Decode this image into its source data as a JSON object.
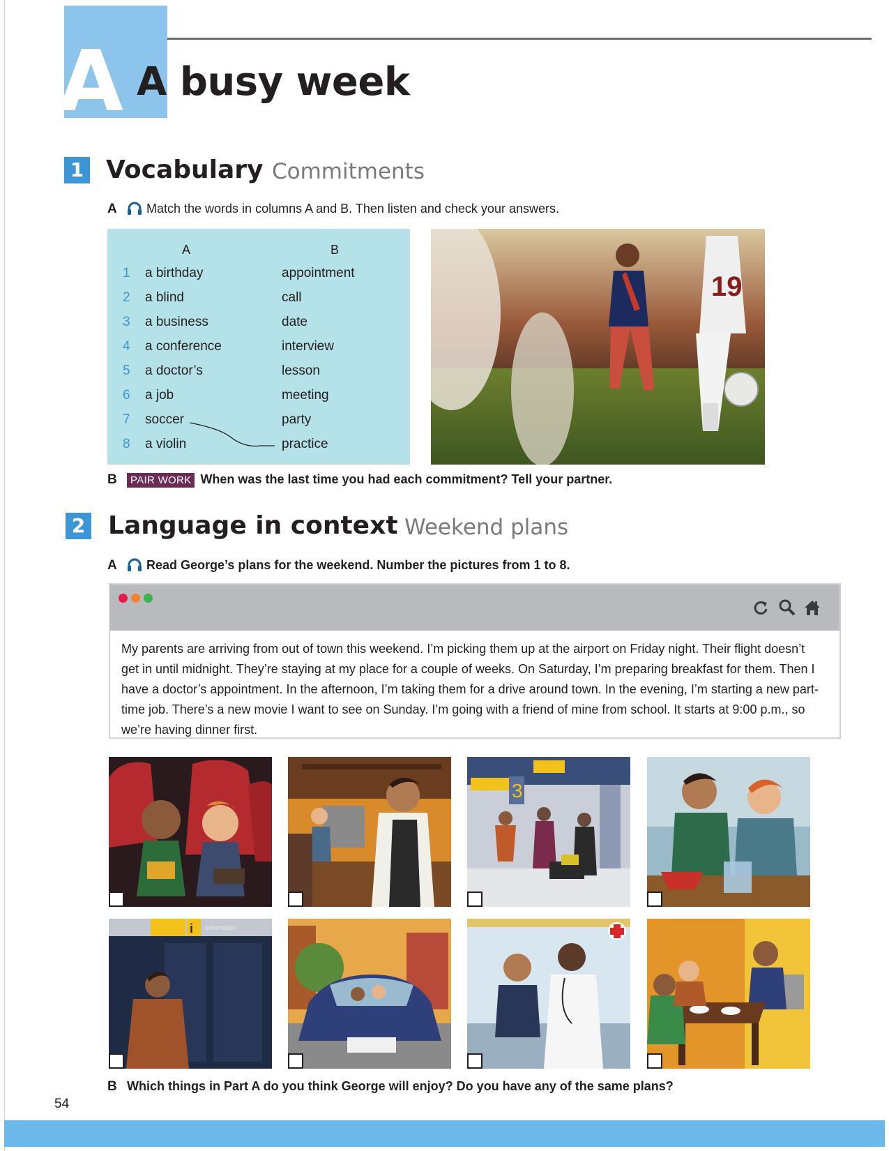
{
  "unit": {
    "letter": "A",
    "title": "A busy week"
  },
  "section1": {
    "number": "1",
    "title": "Vocabulary",
    "subtitle": "Commitments",
    "partA": {
      "letter": "A",
      "instruction": "Match the words in columns A and B. Then listen and check your answers."
    },
    "column_a_header": "A",
    "column_b_header": "B",
    "rows": [
      {
        "num": "1",
        "a": "a birthday",
        "b": "appointment"
      },
      {
        "num": "2",
        "a": "a blind",
        "b": "call"
      },
      {
        "num": "3",
        "a": "a business",
        "b": "date"
      },
      {
        "num": "4",
        "a": "a conference",
        "b": "interview"
      },
      {
        "num": "5",
        "a": "a doctor’s",
        "b": "lesson"
      },
      {
        "num": "6",
        "a": "a job",
        "b": "meeting"
      },
      {
        "num": "7",
        "a": "soccer",
        "b": "party"
      },
      {
        "num": "8",
        "a": "a violin",
        "b": "practice"
      }
    ],
    "photo_number": "19",
    "partB": {
      "letter": "B",
      "badge": "PAIR WORK",
      "instruction": "When was the last time you had each commitment? Tell your partner."
    }
  },
  "section2": {
    "number": "2",
    "title": "Language in context",
    "subtitle": "Weekend plans",
    "partA": {
      "letter": "A",
      "instruction": "Read George’s plans for the weekend. Number the pictures from 1 to 8."
    },
    "browser": {
      "dot_colors": [
        "#e6194b",
        "#f58231",
        "#3cb44b"
      ],
      "icons": [
        "refresh-icon",
        "search-icon",
        "home-icon"
      ],
      "text": "My parents are arriving from out of town this weekend. I’m picking them up at the airport on Friday night. Their flight doesn’t get in until midnight. They’re staying at my place for a couple of weeks. On Saturday, I’m preparing breakfast for them. Then I have a doctor’s appointment. In the afternoon, I’m taking them for a drive around town. In the evening, I’m starting a new part-time job. There’s a new movie I want to see on Sunday. I’m going with a friend of mine from school. It starts at 9:00 p.m., so we’re having dinner first."
    },
    "picture_labels": {
      "gate_number": "3",
      "info_sign": "i",
      "info_text": "Information"
    },
    "partB": {
      "letter": "B",
      "instruction": "Which things in Part A do you think George will enjoy? Do you have any of the same plans?"
    }
  },
  "page_number": "54",
  "colors": {
    "accent_blue": "#3b95d6",
    "unit_blue": "#8cc4ec",
    "vocab_box": "#b5e1e8",
    "pair_work": "#6b2b54",
    "footer": "#6db8ea"
  }
}
